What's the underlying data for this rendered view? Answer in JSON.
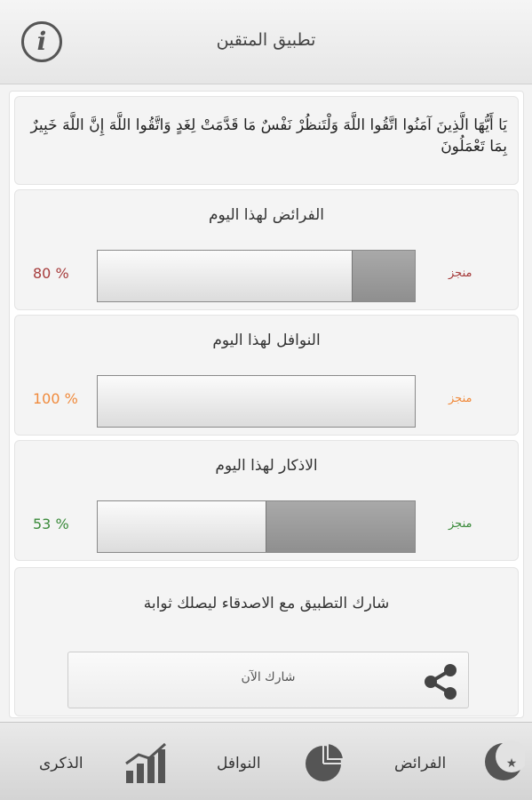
{
  "header": {
    "title": "تطبيق المتقين",
    "info_icon": "info-icon",
    "info_glyph": "i"
  },
  "verse": "يَا أَيُّهَا الَّذِينَ آمَنُوا اتَّقُوا اللَّهَ وَلْتَنظُرْ نَفْسٌ مَا قَدَّمَتْ لِغَدٍ وَاتَّقُوا اللَّهَ إِنَّ اللَّهَ خَبِيرٌ بِمَا تَعْمَلُونَ",
  "tasks": [
    {
      "title": "الفرائض لهذا اليوم",
      "percent_label": "80 %",
      "progress": 0.2,
      "done_label": "منجز",
      "color": "#a63c3c"
    },
    {
      "title": "النوافل لهذا اليوم",
      "percent_label": "100 %",
      "progress": 0.0,
      "done_label": "منجز",
      "color": "#f08a3c"
    },
    {
      "title": "الاذكار لهذا اليوم",
      "percent_label": "53 %",
      "progress": 0.47,
      "done_label": "منجز",
      "color": "#3a8a3a"
    }
  ],
  "share": {
    "text": "شارك التطبيق مع الاصدقاء ليصلك ثوابة",
    "button_label": "شارك الآن",
    "icon": "share-icon"
  },
  "nav": {
    "faraid_label": "الفرائض",
    "faraid_icon": "moon-star-icon",
    "nawafil_label": "النوافل",
    "nawafil_icon": "pie-chart-icon",
    "adhkar_label": "الذكرى",
    "adhkar_icon": "bar-chart-icon"
  }
}
